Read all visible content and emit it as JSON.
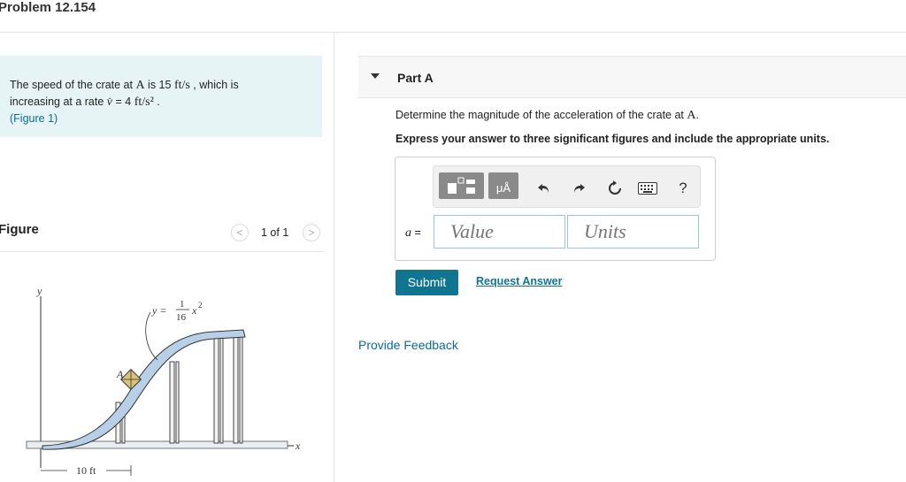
{
  "header": {
    "title": "Problem 12.154"
  },
  "problem": {
    "text_1": "The speed of the crate at ",
    "point": "A",
    "text_2": " is 15 ",
    "unit_1": "ft/s",
    "text_3": " , which is",
    "text_4": "increasing at a rate ",
    "rate_symbol": "v̇",
    "text_5": " = 4 ",
    "unit_2": "ft/s²",
    "text_6": " .",
    "figure_link": "(Figure 1)"
  },
  "figure": {
    "heading": "Figure",
    "pager_prev": "<",
    "pager_next": ">",
    "pager_count": "1 of 1",
    "labels": {
      "y_axis": "y",
      "x_axis": "x",
      "point": "A",
      "equation_lhs": "y =",
      "equation_num": "1",
      "equation_den": "16",
      "equation_var": "x",
      "equation_exp": "2",
      "dimension": "10 ft"
    }
  },
  "part": {
    "title": "Part A",
    "question_1": "Determine the magnitude of the acceleration of the crate at ",
    "question_point": "A",
    "question_2": ".",
    "instruction": "Express your answer to three significant figures and include the appropriate units."
  },
  "toolbar": {
    "units_label": "μÅ",
    "help_label": "?"
  },
  "answer": {
    "variable": "a",
    "equals": " =",
    "value_placeholder": "Value",
    "units_placeholder": "Units"
  },
  "actions": {
    "submit": "Submit",
    "request_answer": "Request Answer",
    "feedback": "Provide Feedback"
  },
  "colors": {
    "accent": "#107591",
    "problem_bg": "#e6f4f5",
    "link": "#0a6b9b"
  }
}
